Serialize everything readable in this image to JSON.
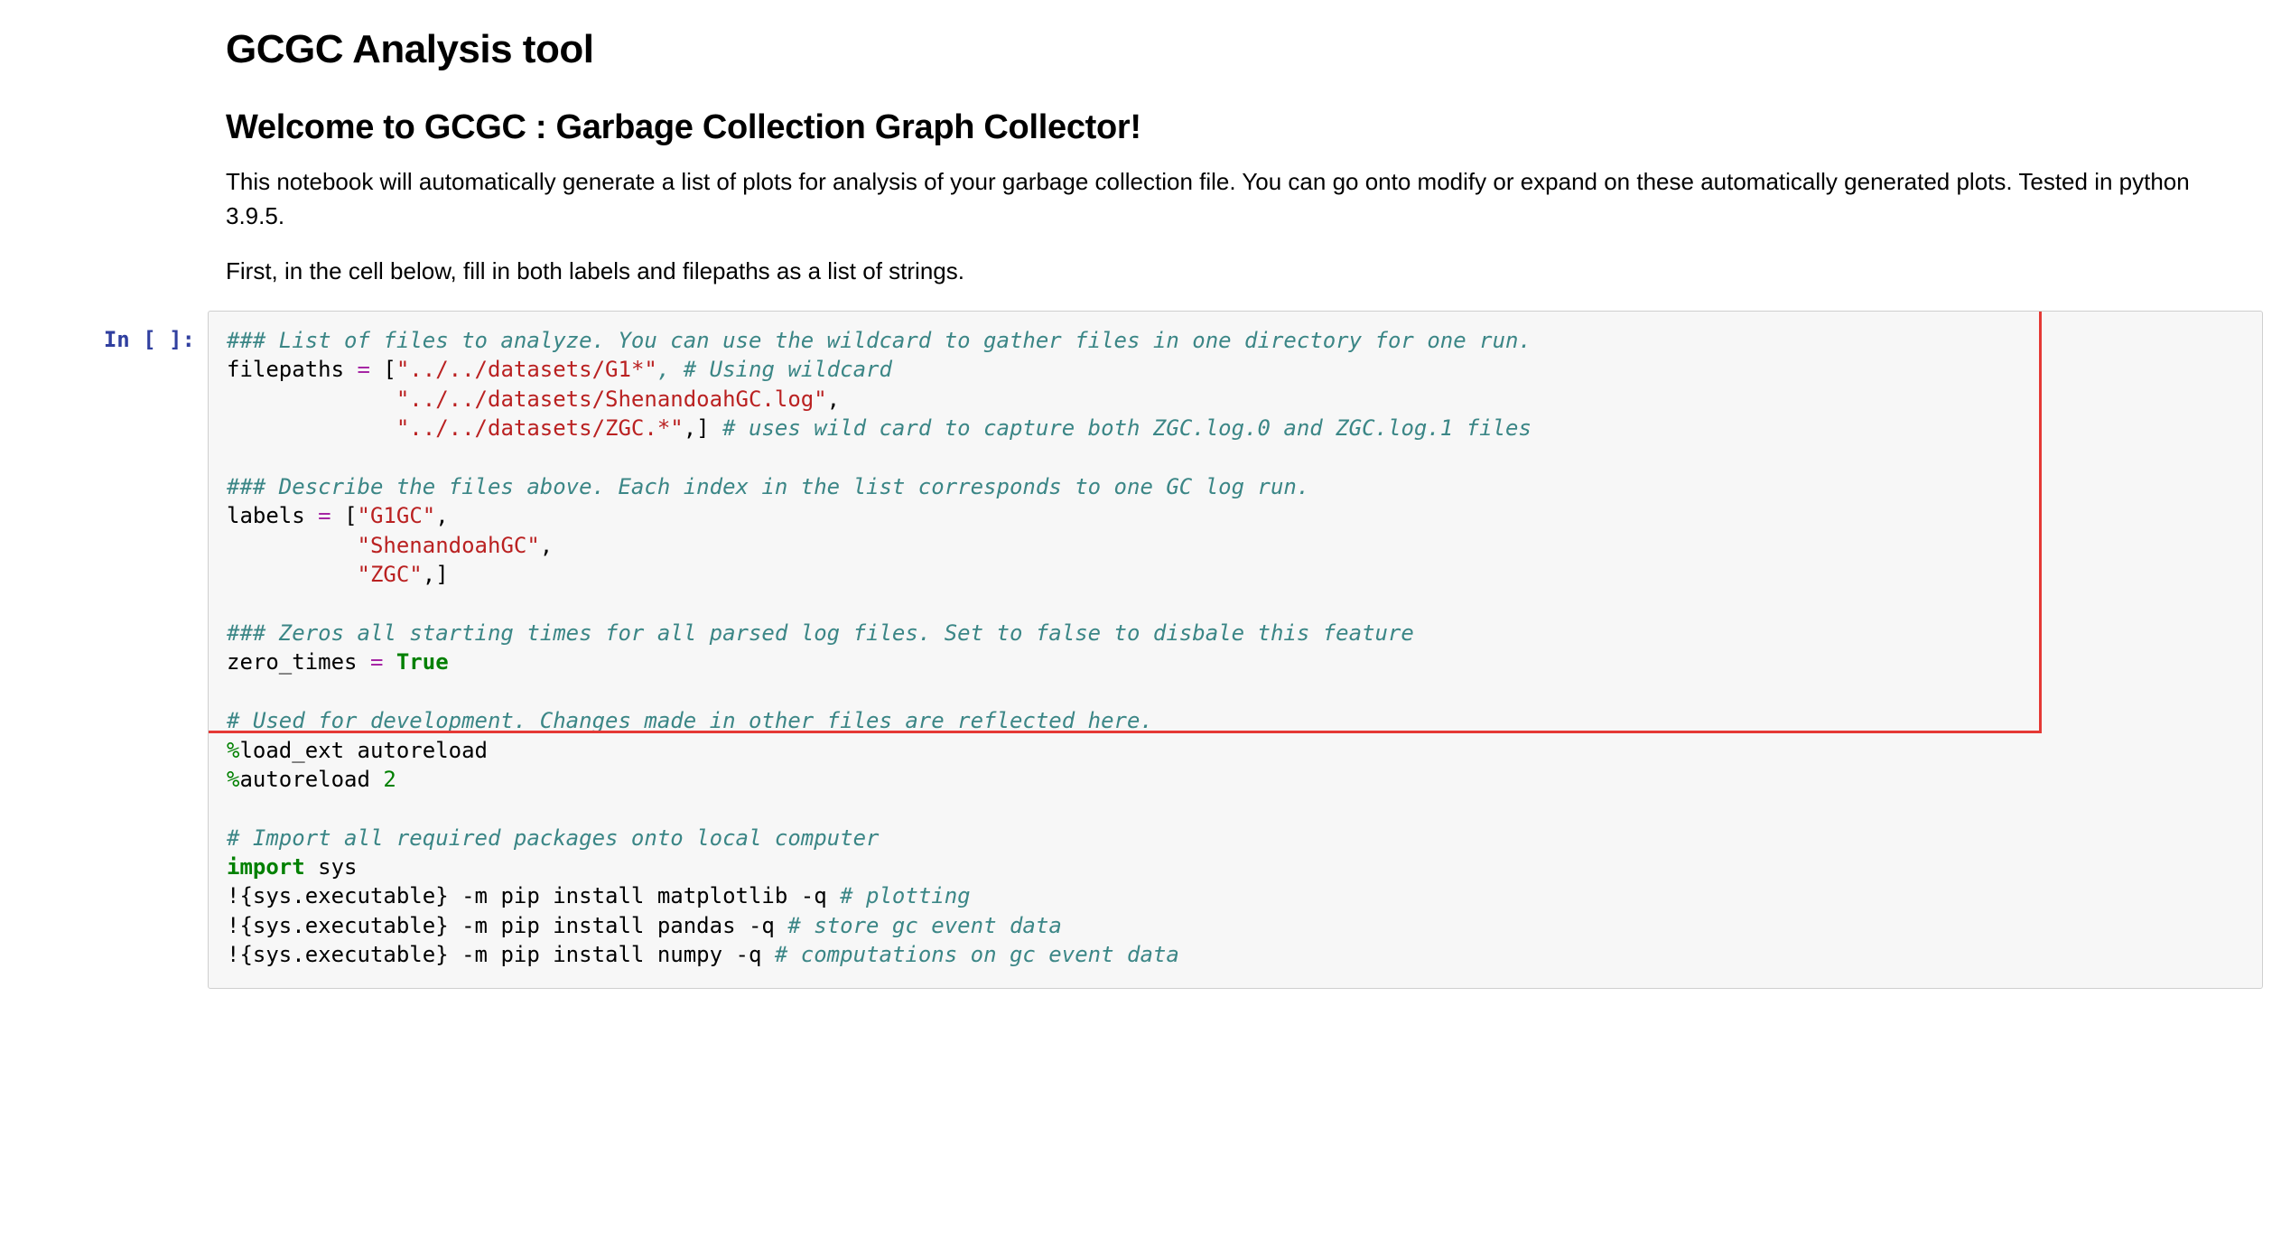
{
  "markdown": {
    "h1": "GCGC Analysis tool",
    "h2": "Welcome to GCGC : Garbage Collection Graph Collector!",
    "p1": "This notebook will automatically generate a list of plots for analysis of your garbage collection file. You can go onto modify or expand on these automatically generated plots. Tested in python 3.9.5.",
    "p2": "First, in the cell below, fill in both labels and filepaths as a list of strings."
  },
  "cell": {
    "prompt": "In [ ]:",
    "code": {
      "c1": "### List of files to analyze. You can use the wildcard to gather files in one directory for one run.",
      "filepaths_name": "filepaths",
      "eq": " = ",
      "lbr": "[",
      "fp0": "\"../../datasets/G1*\"",
      "fp0_comment": ", # Using wildcard",
      "fp1_indent": "             ",
      "fp1": "\"../../datasets/ShenandoahGC.log\"",
      "fp2_indent": "             ",
      "fp2": "\"../../datasets/ZGC.*\"",
      "fp2_tail": ",] ",
      "fp2_comment": "# uses wild card to capture both ZGC.log.0 and ZGC.log.1 files",
      "c2": "### Describe the files above. Each index in the list corresponds to one GC log run.",
      "labels_name": "labels",
      "lbl0": "\"G1GC\"",
      "lbl1_indent": "          ",
      "lbl1": "\"ShenandoahGC\"",
      "lbl2_indent": "          ",
      "lbl2": "\"ZGC\"",
      "lbl_tail": ",]",
      "c3": "### Zeros all starting times for all parsed log files. Set to false to disbale this feature",
      "zt_name": "zero_times",
      "zt_val": "True",
      "c4": "# Used for development. Changes made in other files are reflected here.",
      "magic1_pct": "%",
      "magic1": "load_ext autoreload",
      "magic2_pct": "%",
      "magic2": "autoreload ",
      "magic2_num": "2",
      "c5": "# Import all required packages onto local computer",
      "imp_kw": "import",
      "imp_mod": " sys",
      "bang": "!",
      "pip_prefix": "{sys.executable} -m pip install ",
      "pip_matplotlib": "matplotlib -q ",
      "pip_matplotlib_c": "# plotting",
      "pip_pandas": "pandas -q ",
      "pip_pandas_c": "# store gc event data",
      "pip_numpy": "numpy -q ",
      "pip_numpy_c": "# computations on gc event data"
    }
  }
}
